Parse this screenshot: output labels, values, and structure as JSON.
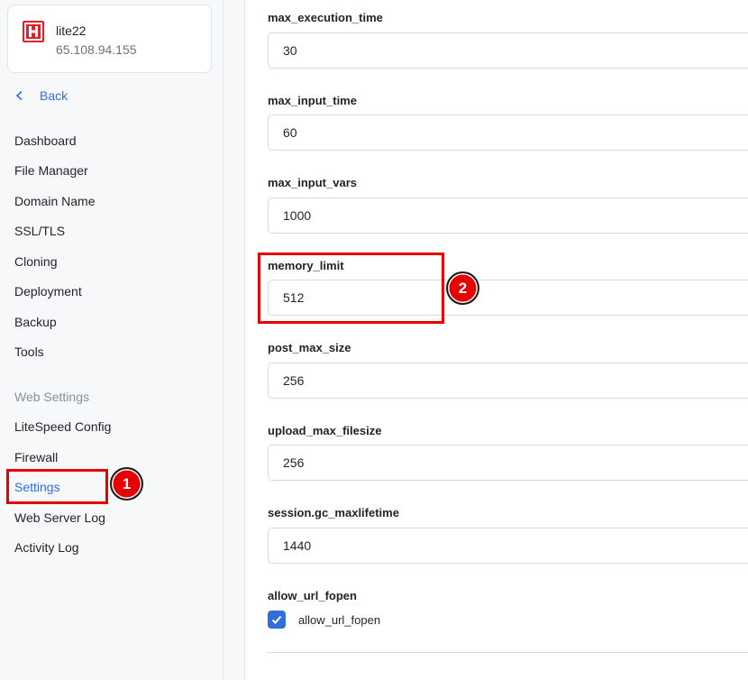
{
  "server": {
    "name": "lite22",
    "ip": "65.108.94.155",
    "logo_letter": "H",
    "logo_color": "#e0202c"
  },
  "sidebar": {
    "back_label": "Back",
    "items": [
      {
        "label": "Dashboard"
      },
      {
        "label": "File Manager"
      },
      {
        "label": "Domain Name"
      },
      {
        "label": "SSL/TLS"
      },
      {
        "label": "Cloning"
      },
      {
        "label": "Deployment"
      },
      {
        "label": "Backup"
      },
      {
        "label": "Tools"
      }
    ],
    "section_title": "Web Settings",
    "section_items": [
      {
        "label": "LiteSpeed Config"
      },
      {
        "label": "Firewall"
      },
      {
        "label": "Settings",
        "active": true
      },
      {
        "label": "Web Server Log"
      },
      {
        "label": "Activity Log"
      }
    ]
  },
  "form": {
    "fields": [
      {
        "label": "max_execution_time",
        "value": "30"
      },
      {
        "label": "max_input_time",
        "value": "60"
      },
      {
        "label": "max_input_vars",
        "value": "1000"
      },
      {
        "label": "memory_limit",
        "value": "512"
      },
      {
        "label": "post_max_size",
        "value": "256"
      },
      {
        "label": "upload_max_filesize",
        "value": "256"
      },
      {
        "label": "session.gc_maxlifetime",
        "value": "1440"
      }
    ],
    "checkbox_section_label": "allow_url_fopen",
    "checkbox_label": "allow_url_fopen",
    "checkbox_checked": true
  },
  "annotations": {
    "badge_1": "1",
    "badge_2": "2"
  },
  "colors": {
    "accent": "#2f6fdb",
    "annotation_red": "#e60000"
  }
}
